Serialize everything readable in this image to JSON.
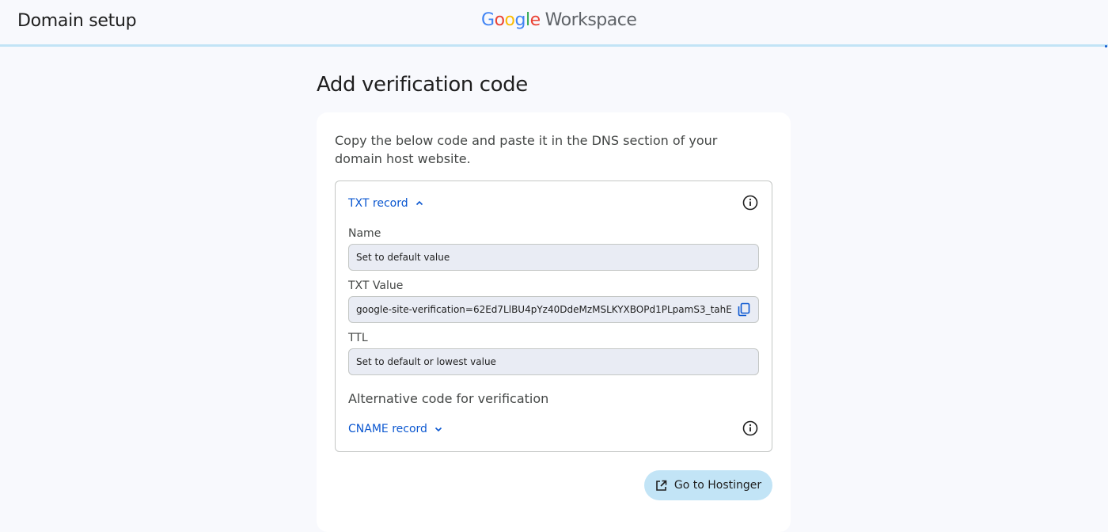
{
  "header": {
    "title": "Domain setup",
    "logo": {
      "google_letters": [
        "G",
        "o",
        "o",
        "g",
        "l",
        "e"
      ],
      "google_colors": [
        "#4285F4",
        "#EA4335",
        "#FBBC05",
        "#4285F4",
        "#34A853",
        "#EA4335"
      ],
      "product": "Workspace"
    }
  },
  "main": {
    "title": "Add verification code",
    "instructions": "Copy the below code and paste it in the DNS section of your domain host website.",
    "txt_record": {
      "toggle_label": "TXT record",
      "toggle_icon": "chevron-up-icon",
      "info_icon": "info-icon",
      "name_label": "Name",
      "name_value": "Set to default value",
      "txt_value_label": "TXT Value",
      "txt_value": "google-site-verification=62Ed7LlBU4pYz40DdeMzMSLKYXBOPd1PLpamS3_tahE",
      "copy_icon": "copy-icon",
      "ttl_label": "TTL",
      "ttl_value": "Set to default or lowest value"
    },
    "alternative": {
      "heading": "Alternative code for verification",
      "toggle_label": "CNAME record",
      "toggle_icon": "chevron-down-icon",
      "info_icon": "info-icon"
    },
    "action_button": {
      "label": "Go to Hostinger",
      "icon": "open-in-new-icon"
    }
  },
  "colors": {
    "background": "#f8f9fd",
    "link": "#0b57d0",
    "button_bg": "#c2e4f6",
    "field_bg": "#e9ecf4"
  }
}
